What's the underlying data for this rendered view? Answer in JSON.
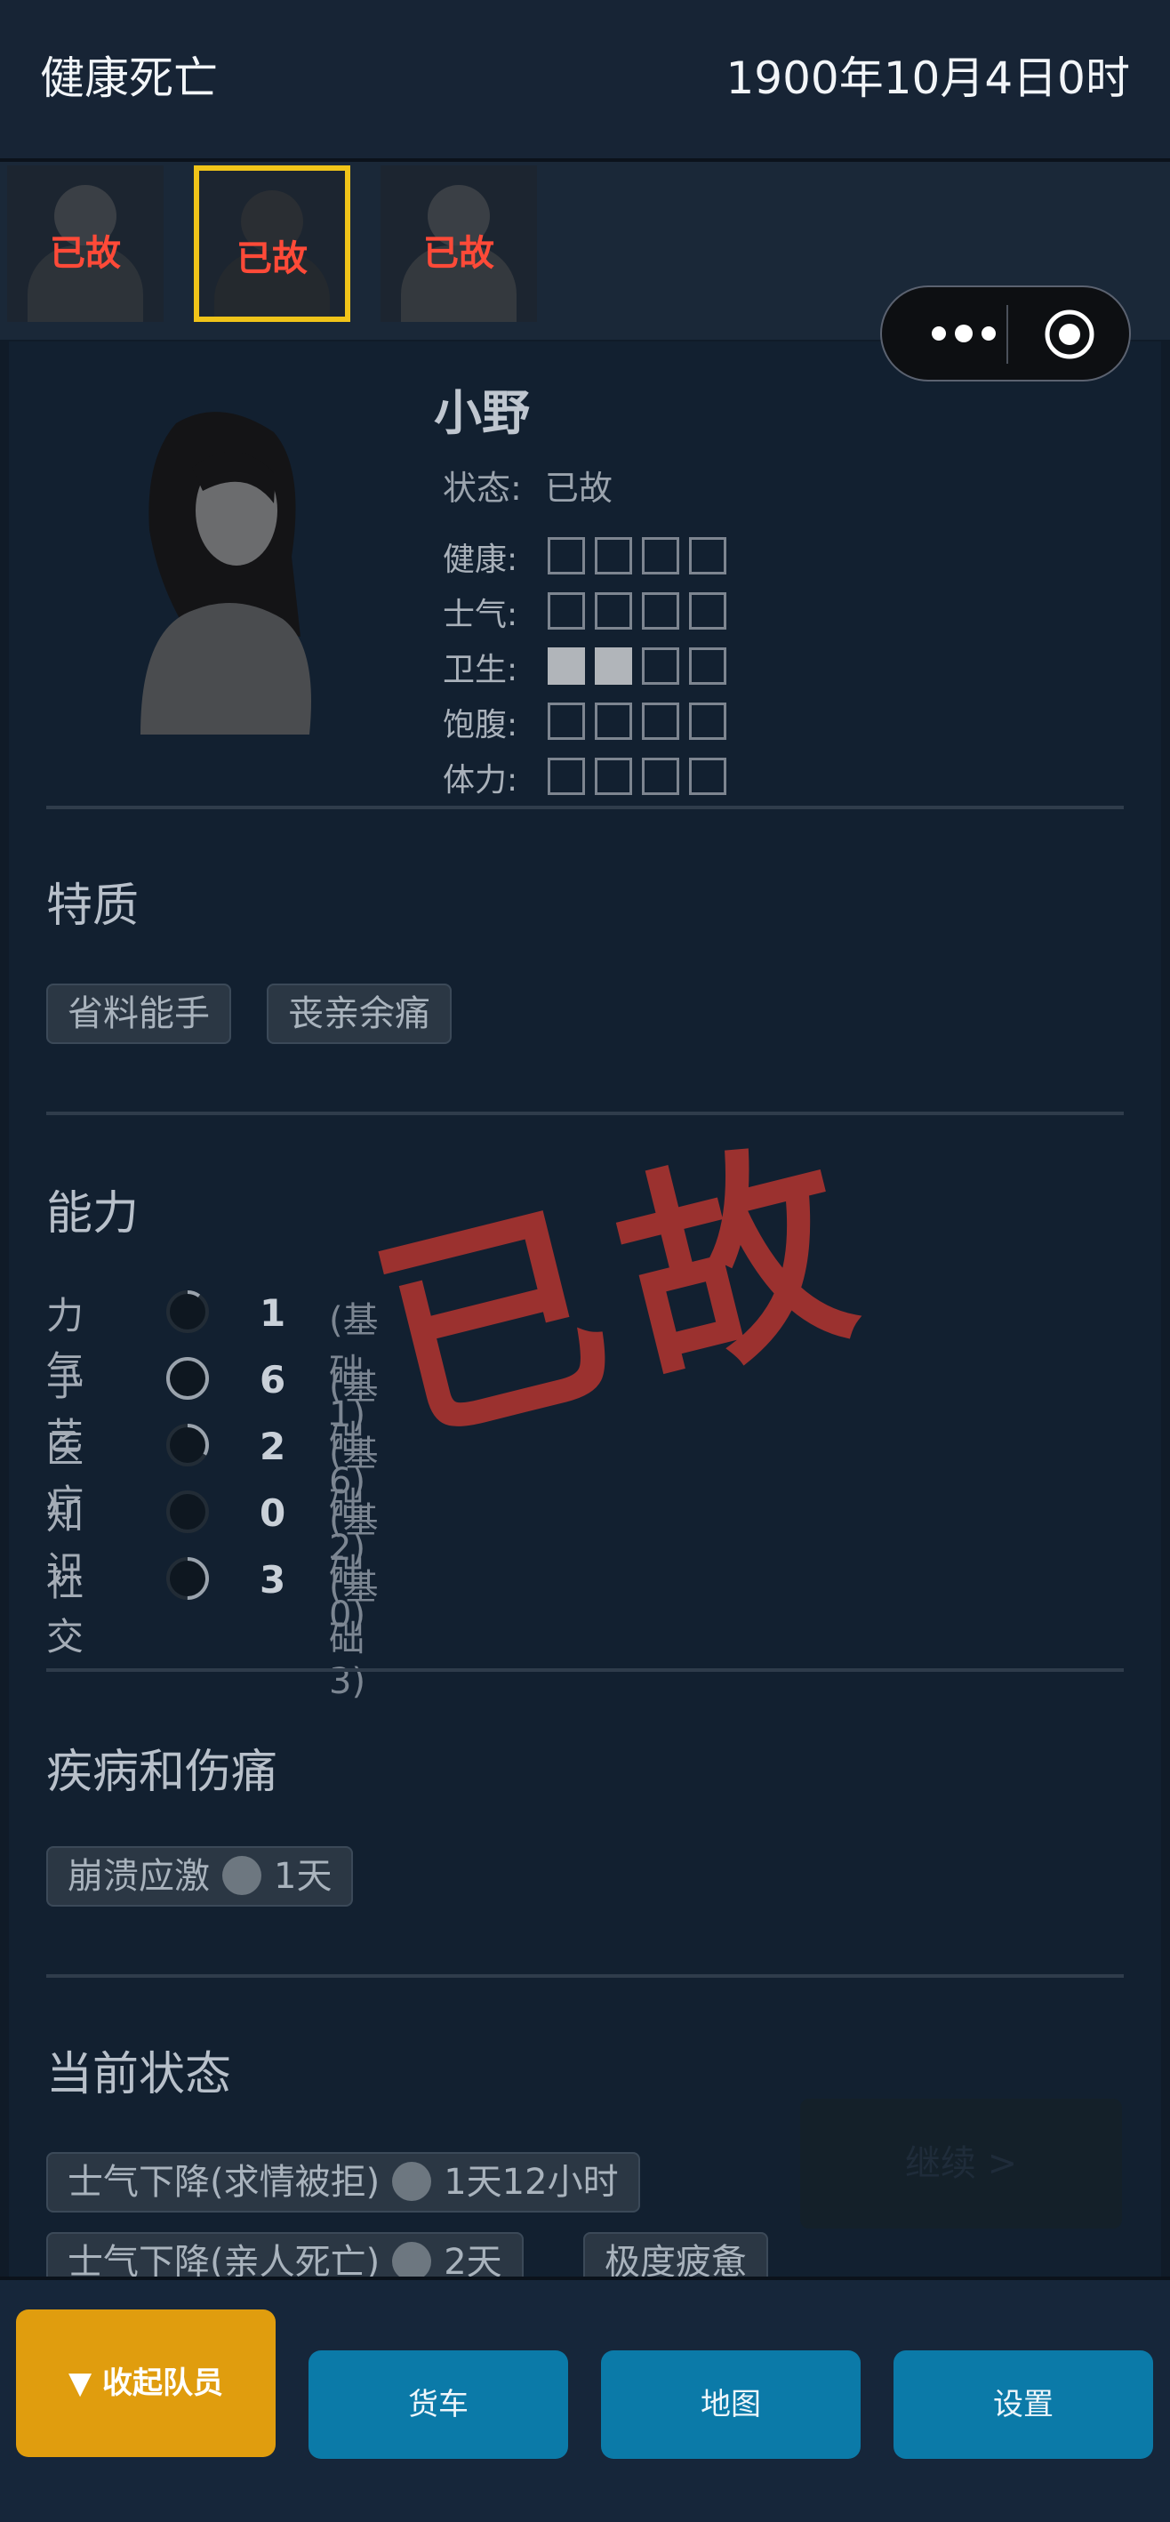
{
  "header": {
    "title": "健康死亡",
    "datetime": "1900年10月4日0时"
  },
  "roster": [
    {
      "label": "已故",
      "selected": false
    },
    {
      "label": "已故",
      "selected": true
    },
    {
      "label": "已故",
      "selected": false
    }
  ],
  "character": {
    "name": "小野",
    "status_label": "状态:",
    "status_value": "已故",
    "stats": [
      {
        "label": "健康:",
        "value": 0,
        "max": 4
      },
      {
        "label": "士气:",
        "value": 0,
        "max": 4
      },
      {
        "label": "卫生:",
        "value": 2,
        "max": 4
      },
      {
        "label": "饱腹:",
        "value": 0,
        "max": 4
      },
      {
        "label": "体力:",
        "value": 0,
        "max": 4
      }
    ]
  },
  "traits": {
    "title": "特质",
    "items": [
      "省料能手",
      "丧亲余痛"
    ]
  },
  "abilities": {
    "title": "能力",
    "items": [
      {
        "label": "力气",
        "value": "1",
        "base": "(基础 1)",
        "ring": 0.1
      },
      {
        "label": "手艺",
        "value": "6",
        "base": "(基础 6)",
        "ring": 1.0
      },
      {
        "label": "医疗",
        "value": "2",
        "base": "(基础 2)",
        "ring": 0.33
      },
      {
        "label": "知识",
        "value": "0",
        "base": "(基础 0)",
        "ring": 0.0
      },
      {
        "label": "社交",
        "value": "3",
        "base": "(基础 3)",
        "ring": 0.5
      }
    ]
  },
  "illness": {
    "title": "疾病和伤痛",
    "items": [
      {
        "label": "崩溃应激",
        "duration": "1天"
      }
    ]
  },
  "current_status": {
    "title": "当前状态",
    "items": [
      {
        "label": "士气下降(求情被拒)",
        "duration": "1天12小时"
      },
      {
        "label": "士气下降(亲人死亡)",
        "duration": "2天"
      },
      {
        "label": "极度疲惫",
        "duration": ""
      }
    ]
  },
  "stamp": "已故",
  "continue_label": "继续 >",
  "bottom_nav": {
    "collapse": "▼ 收起队员",
    "truck": "货车",
    "map": "地图",
    "settings": "设置"
  },
  "colors": {
    "accent_yellow": "#e09d0e",
    "nav_blue": "#0b7aa8",
    "dead_red": "#ff4a38",
    "stamp_red": "#a7332f"
  }
}
